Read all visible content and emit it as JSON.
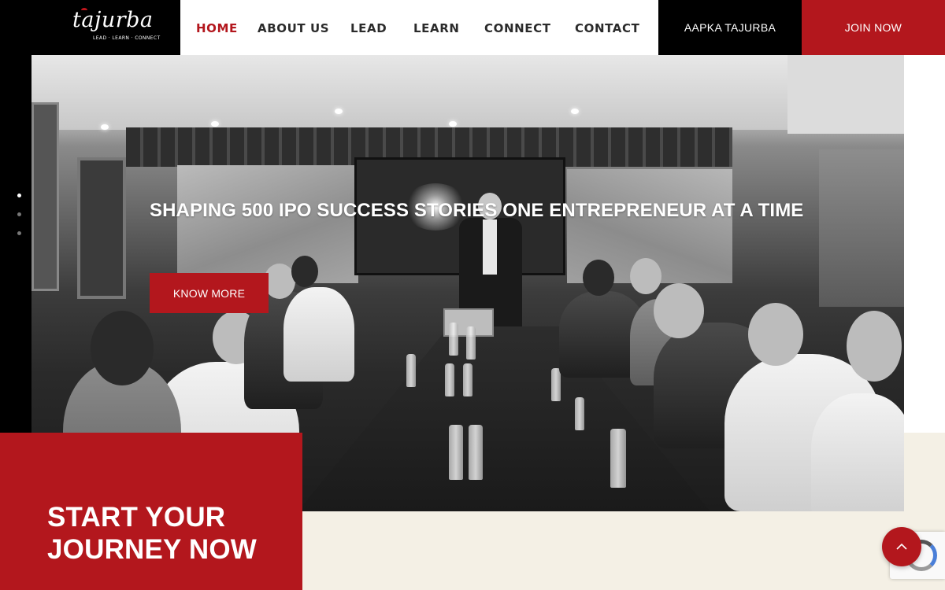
{
  "brand": {
    "logo_text": "tajurba",
    "tagline": "LEAD · LEARN · CONNECT"
  },
  "nav": {
    "items": [
      {
        "label": "HOME",
        "active": true
      },
      {
        "label": "ABOUT US",
        "active": false
      },
      {
        "label": "LEAD",
        "active": false
      },
      {
        "label": "LEARN",
        "active": false
      },
      {
        "label": "CONNECT",
        "active": false
      },
      {
        "label": "CONTACT",
        "active": false
      }
    ],
    "aapka_label": "AAPKA TAJURBA",
    "join_label": "JOIN NOW"
  },
  "hero": {
    "title": "SHAPING 500 IPO SUCCESS STORIES ONE ENTREPRENEUR AT A TIME",
    "cta_label": "KNOW MORE",
    "slides": 3,
    "active_slide": 1
  },
  "journey": {
    "text_line1": "START YOUR",
    "text_line2": "JOURNEY NOW"
  },
  "colors": {
    "accent": "#b3171d",
    "dark": "#000000",
    "cream": "#f4f0e5"
  },
  "icons": {
    "scroll_top": "chevron-up-icon",
    "recaptcha": "recaptcha-icon"
  }
}
